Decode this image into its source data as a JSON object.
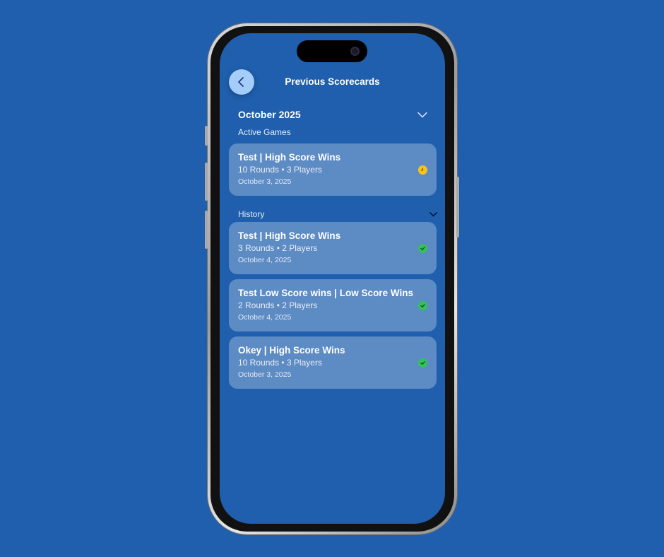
{
  "header": {
    "title": "Previous Scorecards"
  },
  "month": {
    "label": "October 2025"
  },
  "active_section": {
    "label": "Active Games",
    "games": [
      {
        "title": "Test  | High Score Wins",
        "meta": "10 Rounds • 3 Players",
        "date": "October 3, 2025",
        "status": "in-progress"
      }
    ]
  },
  "history_section": {
    "label": "History",
    "games": [
      {
        "title": "Test | High Score Wins",
        "meta": "3 Rounds • 2 Players",
        "date": "October 4, 2025",
        "status": "completed"
      },
      {
        "title": "Test Low Score wins | Low Score Wins",
        "meta": "2 Rounds • 2 Players",
        "date": "October 4, 2025",
        "status": "completed"
      },
      {
        "title": "Okey | High Score Wins",
        "meta": "10 Rounds • 3 Players",
        "date": "October 3, 2025",
        "status": "completed"
      }
    ]
  },
  "colors": {
    "background": "#1f5fad",
    "back_button": "#a4cdfa",
    "active_status": "#f7c519",
    "completed_status": "#33c25a"
  },
  "icons": {
    "back": "chevron-left-icon",
    "month_toggle": "chevron-down-icon",
    "history_toggle": "chevron-down-icon",
    "active_status": "clock-icon",
    "completed_status": "checkmark-icon"
  }
}
